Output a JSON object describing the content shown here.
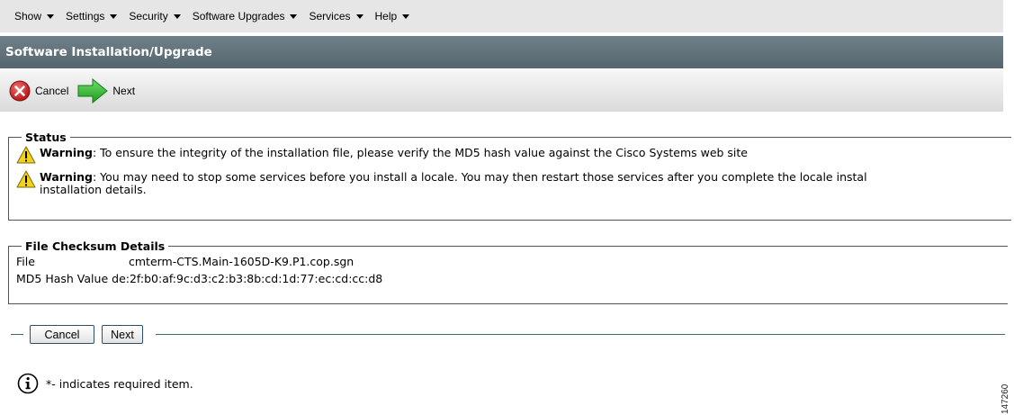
{
  "menu": {
    "items": [
      {
        "label": "Show"
      },
      {
        "label": "Settings"
      },
      {
        "label": "Security"
      },
      {
        "label": "Software Upgrades"
      },
      {
        "label": "Services"
      },
      {
        "label": "Help"
      }
    ]
  },
  "page_title": "Software Installation/Upgrade",
  "toolbar": {
    "cancel_label": "Cancel",
    "next_label": "Next"
  },
  "status": {
    "legend": "Status",
    "warnings": [
      {
        "prefix": "Warning",
        "text": ": To ensure the integrity of the installation file, please verify the MD5 hash value against the Cisco Systems web site"
      },
      {
        "prefix": "Warning",
        "text": ": You may need to stop some services before you install a locale. You may then restart those services after you complete the locale instal",
        "text2": "installation details."
      }
    ]
  },
  "checksum": {
    "legend": "File Checksum Details",
    "file_label": "File",
    "file_value": "cmterm-CTS.Main-1605D-K9.P1.cop.sgn",
    "md5_label": "MD5 Hash Value",
    "md5_value": "de:2f:b0:af:9c:d3:c2:b3:8b:cd:1d:77:ec:cd:cc:d8"
  },
  "buttons": {
    "cancel": "Cancel",
    "next": "Next"
  },
  "footer": {
    "required_note": "*- indicates required item."
  },
  "figure_code": "147260",
  "colors": {
    "menubar_bg": "#e6e6e6",
    "titlebar_bg": "#5f6f78",
    "cancel_icon": "#cc2222",
    "next_arrow": "#33b533",
    "warning_icon": "#f5d21a"
  }
}
